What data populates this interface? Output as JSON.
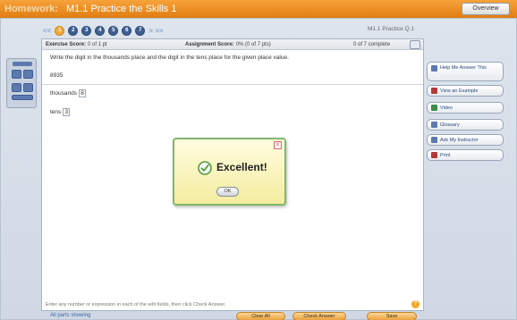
{
  "window": {
    "section": "Homework:",
    "title": "M1.1 Practice the Skills 1",
    "overview_label": "Overview"
  },
  "nav": {
    "prev": "<<",
    "next": "> >>",
    "questions": [
      "1",
      "2",
      "3",
      "4",
      "5",
      "6",
      "7"
    ],
    "active_index": 0,
    "practice_label": "M1.1 Practice Q.1"
  },
  "scores": {
    "exercise_label": "Exercise Score:",
    "exercise_value": "0 of 1 pt",
    "assignment_label": "Assignment Score:",
    "assignment_value": "0% (0 of 7 pts)",
    "complete": "0 of 7 complete"
  },
  "question": {
    "instruction": "Write the digit in the thousands place and the digit in the tens place for the given place value.",
    "number": "8935",
    "answers": [
      {
        "label": "thousands",
        "value": "8"
      },
      {
        "label": "tens",
        "value": "3"
      }
    ],
    "footer_hint": "Enter any number or expression in each of the edit fields, then click Check Answer."
  },
  "dialog": {
    "message": "Excellent!",
    "ok": "OK",
    "close": "x"
  },
  "sidebar": {
    "buttons": [
      {
        "label": "Help Me Answer This",
        "icon": "help-me-answer-icon",
        "color": "#5d7ab0"
      },
      {
        "label": "View an Example",
        "icon": "example-icon",
        "color": "#b33a3a"
      },
      {
        "label": "Video",
        "icon": "video-icon",
        "color": "#3e8c4a"
      },
      {
        "label": "Glossary",
        "icon": "glossary-icon",
        "color": "#5d7ab0"
      },
      {
        "label": "Ask My Instructor",
        "icon": "ask-instructor-icon",
        "color": "#5d7ab0"
      },
      {
        "label": "Print",
        "icon": "print-icon",
        "color": "#b33a3a"
      }
    ]
  },
  "bottom": {
    "all_parts": "All parts showing",
    "clear_all": "Clear All",
    "check_answer": "Check Answer",
    "save": "Save"
  },
  "colors": {
    "accent": "#f4a73c",
    "navy": "#3f5f93",
    "dialog_border": "#7fb86a"
  }
}
